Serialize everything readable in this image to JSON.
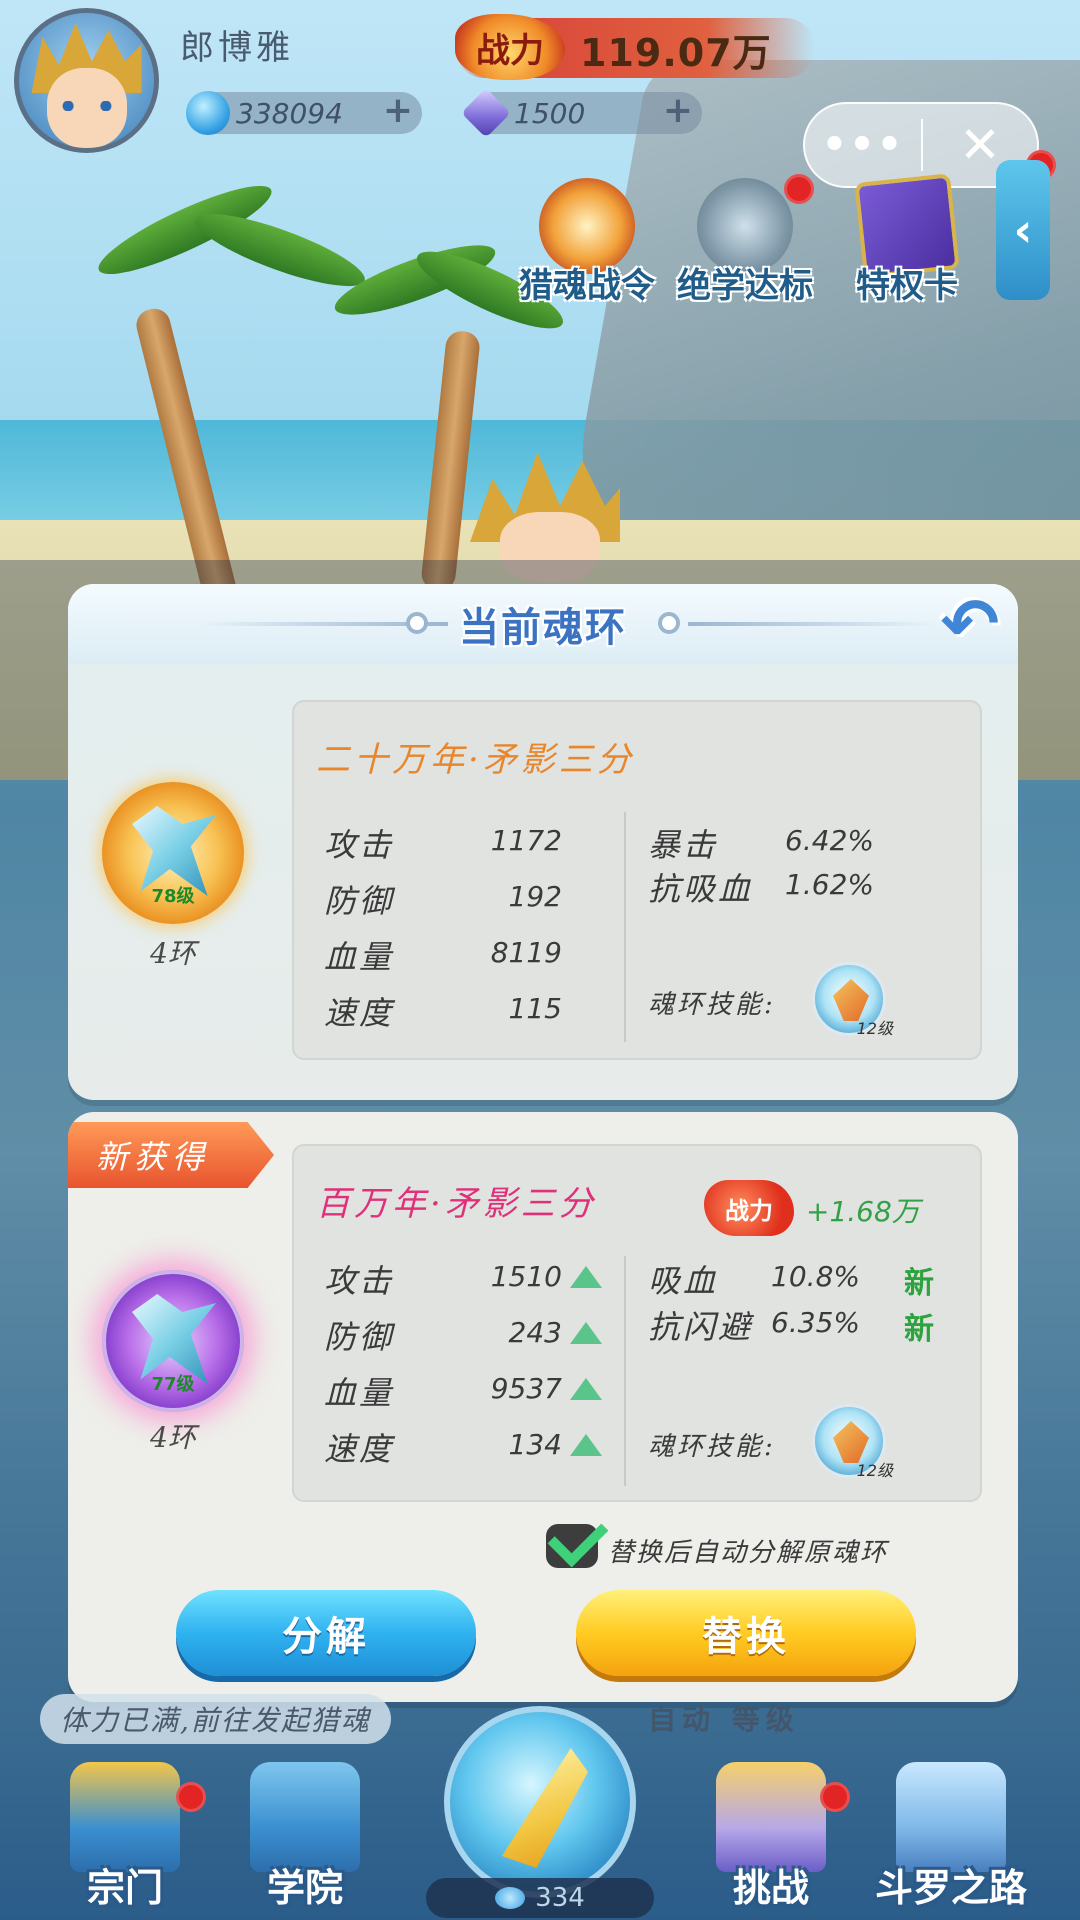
{
  "hud": {
    "player_name": "郎博雅",
    "power_label": "战力",
    "power_value": "119.07万",
    "resources": [
      {
        "icon": "soul-drop-icon",
        "value": "338094"
      },
      {
        "icon": "crystal-icon",
        "value": "1500"
      }
    ],
    "mini_program_menu": {
      "more": "•••",
      "close": "✕"
    }
  },
  "activities": [
    {
      "label": "猎魂战令",
      "icon": "phoenix-icon"
    },
    {
      "label": "绝学达标",
      "icon": "scroll-icon"
    },
    {
      "label": "特权卡",
      "icon": "privilege-card-icon"
    }
  ],
  "current_panel": {
    "title": "当前魂环",
    "ring_level": "78级",
    "ring_slot": "4环",
    "ring_name": "二十万年·矛影三分",
    "stats_left": [
      {
        "name": "攻击",
        "value": "1172"
      },
      {
        "name": "防御",
        "value": "192"
      },
      {
        "name": "血量",
        "value": "8119"
      },
      {
        "name": "速度",
        "value": "115"
      }
    ],
    "stats_right": [
      {
        "name": "暴击",
        "value": "6.42%"
      },
      {
        "name": "抗吸血",
        "value": "1.62%"
      }
    ],
    "skill_label": "魂环技能:",
    "skill_level": "12级"
  },
  "new_panel": {
    "flag": "新获得",
    "ring_level": "77级",
    "ring_slot": "4环",
    "ring_name": "百万年·矛影三分",
    "power_badge": "战力",
    "power_delta": "+1.68万",
    "stats_left": [
      {
        "name": "攻击",
        "value": "1510"
      },
      {
        "name": "防御",
        "value": "243"
      },
      {
        "name": "血量",
        "value": "9537"
      },
      {
        "name": "速度",
        "value": "134"
      }
    ],
    "stats_right": [
      {
        "name": "吸血",
        "value": "10.8%",
        "tag": "新"
      },
      {
        "name": "抗闪避",
        "value": "6.35%",
        "tag": "新"
      }
    ],
    "skill_label": "魂环技能:",
    "skill_level": "12级",
    "auto_decompose_label": "替换后自动分解原魂环",
    "auto_decompose_checked": true,
    "decompose_button": "分解",
    "replace_button": "替换"
  },
  "bottom": {
    "tip": "体力已满,前往发起猎魂",
    "auto_label": "自动",
    "level_label": "等级",
    "orb_count": "334",
    "nav": [
      {
        "label": "宗门"
      },
      {
        "label": "学院"
      },
      {
        "label": "挑战"
      },
      {
        "label": "斗罗之路"
      }
    ]
  }
}
